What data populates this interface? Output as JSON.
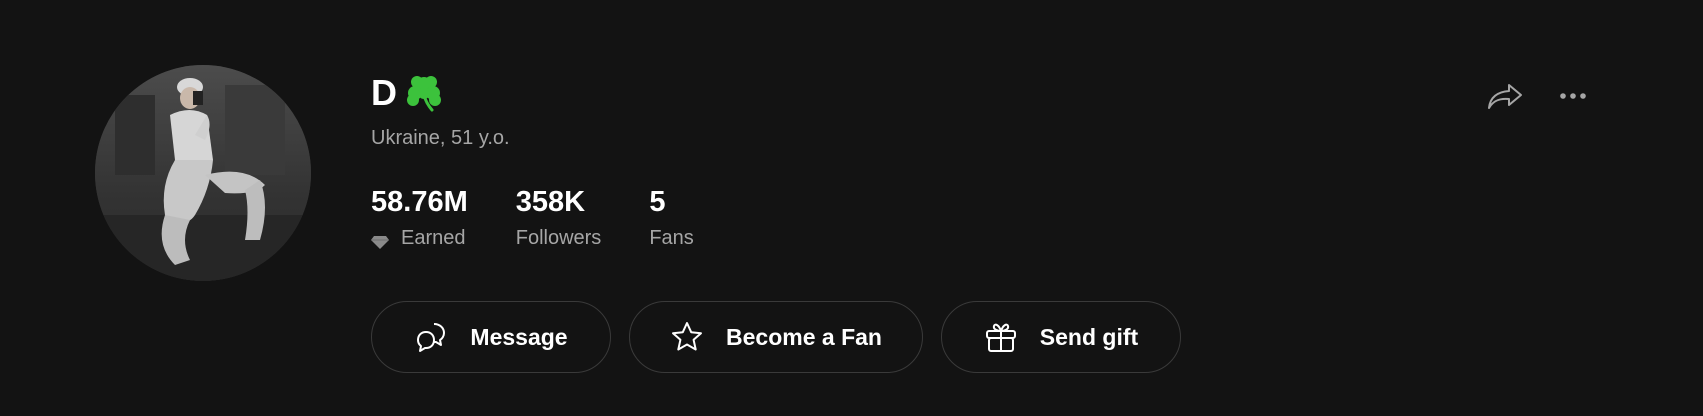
{
  "profile": {
    "name": "D",
    "emoji_icon": "shamrock-icon",
    "location": "Ukraine, 51 y.o.",
    "avatar_icon": "profile-photo"
  },
  "stats": [
    {
      "value": "58.76M",
      "label": "Earned",
      "icon": "diamond-icon"
    },
    {
      "value": "358K",
      "label": "Followers"
    },
    {
      "value": "5",
      "label": "Fans"
    }
  ],
  "actions": {
    "message_label": "Message",
    "fan_label": "Become a Fan",
    "gift_label": "Send gift"
  },
  "top_actions": {
    "share_icon": "share-icon",
    "more_icon": "more-icon"
  },
  "colors": {
    "background": "#131313",
    "text_primary": "#ffffff",
    "text_secondary": "#a6a6a6",
    "button_border": "#3a3a3a",
    "shamrock": "#3cc23c"
  }
}
